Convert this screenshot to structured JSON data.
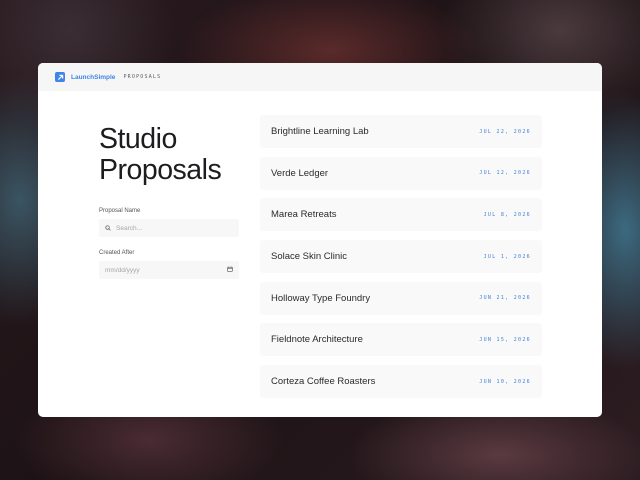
{
  "brand": {
    "name": "LaunchSimple",
    "section": "PROPOSALS",
    "accent": "#3d86e8"
  },
  "page": {
    "title_line1": "Studio",
    "title_line2": "Proposals"
  },
  "filters": {
    "name_label": "Proposal Name",
    "name_placeholder": "Search...",
    "date_label": "Created After",
    "date_placeholder": "mm/dd/yyyy"
  },
  "proposals": [
    {
      "name": "Brightline Learning Lab",
      "date": "JUL 22, 2026"
    },
    {
      "name": "Verde Ledger",
      "date": "JUL 12, 2026"
    },
    {
      "name": "Marea Retreats",
      "date": "JUL 8, 2026"
    },
    {
      "name": "Solace Skin Clinic",
      "date": "JUL 1, 2026"
    },
    {
      "name": "Holloway Type Foundry",
      "date": "JUN 21, 2026"
    },
    {
      "name": "Fieldnote Architecture",
      "date": "JUN 15, 2026"
    },
    {
      "name": "Corteza Coffee Roasters",
      "date": "JUN 10, 2026"
    }
  ],
  "icons": {
    "logo": "arrow-up-right-icon",
    "search": "search-icon",
    "calendar": "calendar-icon"
  }
}
